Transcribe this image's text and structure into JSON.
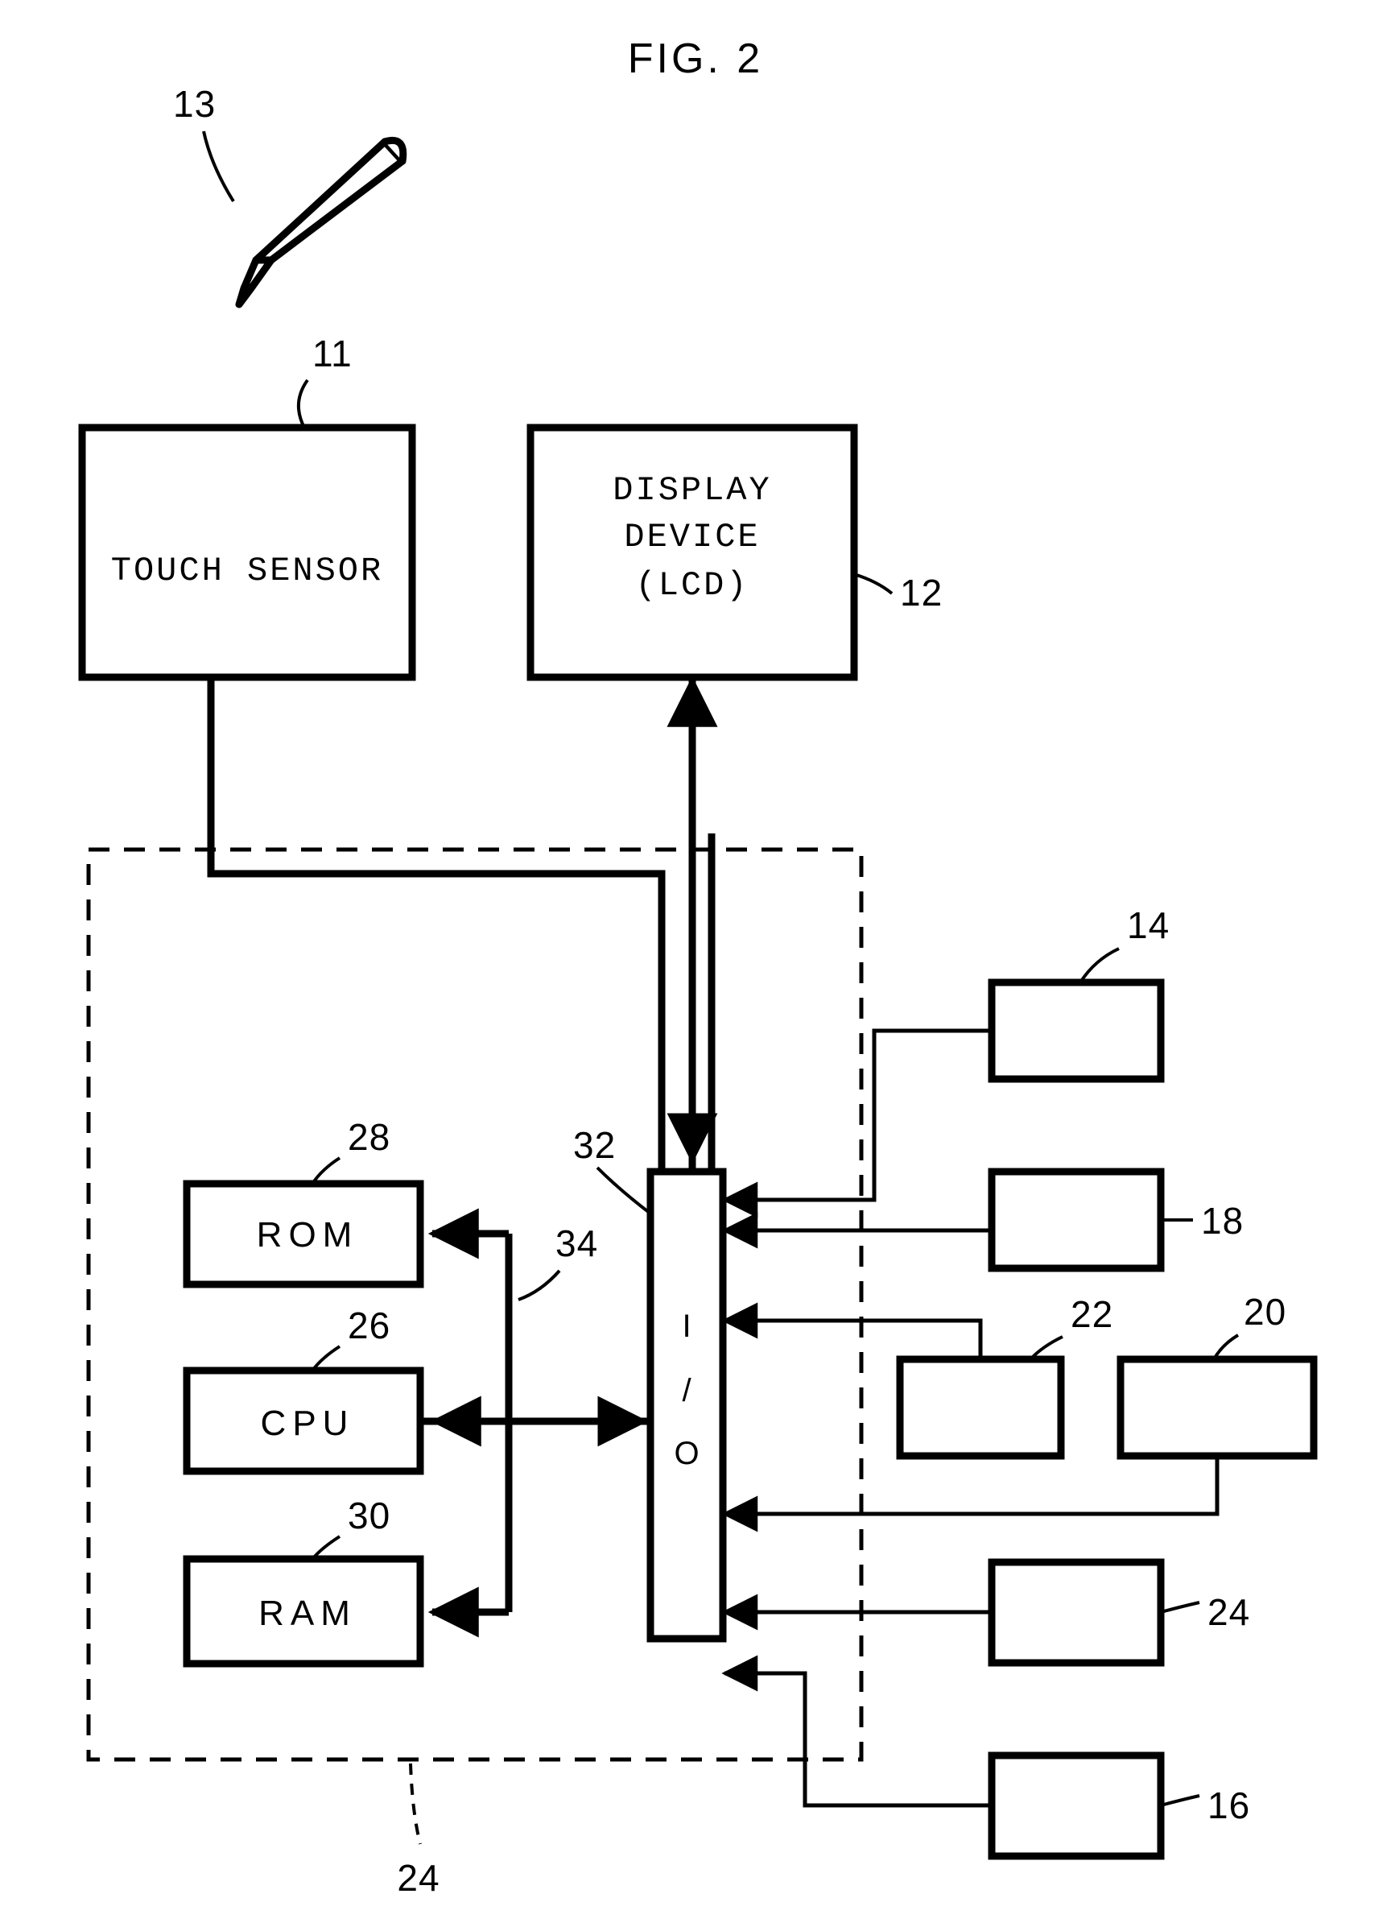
{
  "figure": {
    "title": "FIG. 2",
    "type": "patent-block-diagram"
  },
  "blocks": {
    "touch_sensor": {
      "label": "TOUCH SENSOR",
      "ref": "11"
    },
    "display_device": {
      "line1": "DISPLAY",
      "line2": "DEVICE",
      "line3": "(LCD)",
      "ref": "12"
    },
    "rom": {
      "label": "ROM",
      "ref": "28"
    },
    "cpu": {
      "label": "CPU",
      "ref": "26"
    },
    "ram": {
      "label": "RAM",
      "ref": "30"
    },
    "io": {
      "line1": "I",
      "line2": "/",
      "line3": "O",
      "ref": "32"
    },
    "bus": {
      "ref": "34"
    },
    "enclosure": {
      "ref": "24"
    },
    "peripheral_14": {
      "ref": "14"
    },
    "peripheral_18": {
      "ref": "18"
    },
    "peripheral_22": {
      "ref": "22"
    },
    "peripheral_20": {
      "ref": "20"
    },
    "peripheral_24": {
      "ref": "24"
    },
    "peripheral_16": {
      "ref": "16"
    },
    "stylus": {
      "ref": "13"
    }
  },
  "colors": {
    "ink": "#000000",
    "paper": "#ffffff"
  }
}
